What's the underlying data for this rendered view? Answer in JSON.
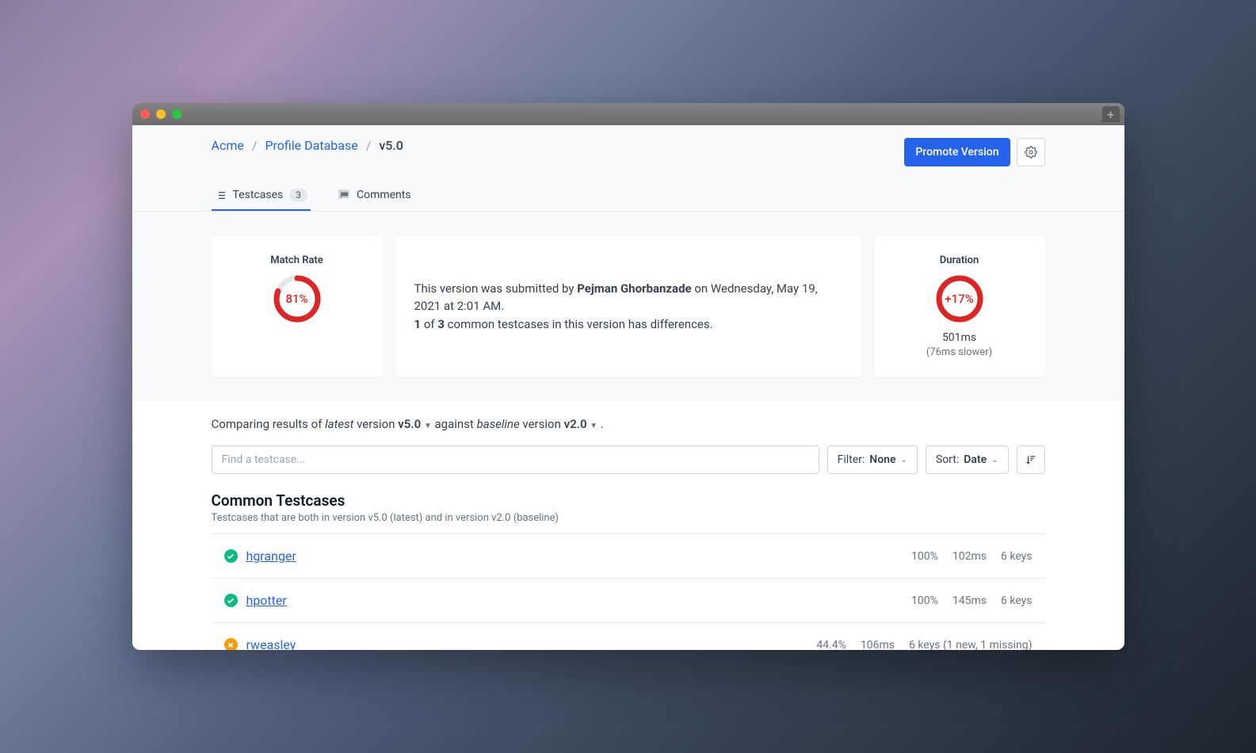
{
  "breadcrumb": {
    "org": "Acme",
    "project": "Profile Database",
    "version": "v5.0"
  },
  "actions": {
    "promote": "Promote Version"
  },
  "tabs": {
    "testcases": "Testcases",
    "testcases_count": "3",
    "comments": "Comments"
  },
  "matchRate": {
    "title": "Match Rate",
    "value": "81%",
    "pct": 81
  },
  "summary": {
    "prefix": "This version was submitted by ",
    "author": "Pejman Ghorbanzade",
    "suffix": " on Wednesday, May 19, 2021 at 2:01 AM.",
    "l2a": "1",
    "l2b": " of ",
    "l2c": "3",
    "l2d": " common testcases in this version has differences."
  },
  "duration": {
    "title": "Duration",
    "value": "+17%",
    "pct": 17,
    "ms": "501ms",
    "note": "(76ms slower)"
  },
  "comparing": {
    "a": "Comparing results of ",
    "latest": "latest",
    "b": " version ",
    "v1": "v5.0",
    "c": " against ",
    "baseline": "baseline",
    "d": " version ",
    "v2": "v2.0",
    "e": " ."
  },
  "search": {
    "placeholder": "Find a testcase..."
  },
  "filter": {
    "label": "Filter: ",
    "value": "None"
  },
  "sort": {
    "label": "Sort: ",
    "value": "Date"
  },
  "section": {
    "title": "Common Testcases",
    "sub": "Testcases that are both in version v5.0 (latest) and in version v2.0 (baseline)"
  },
  "rows": [
    {
      "status": "ok",
      "name": "hgranger",
      "match": "100%",
      "dur": "102ms",
      "keys": "6 keys"
    },
    {
      "status": "ok",
      "name": "hpotter",
      "match": "100%",
      "dur": "145ms",
      "keys": "6 keys"
    },
    {
      "status": "warn",
      "name": "rweasley",
      "match": "44.4%",
      "dur": "106ms",
      "keys": "6 keys (1 new, 1 missing)"
    }
  ]
}
